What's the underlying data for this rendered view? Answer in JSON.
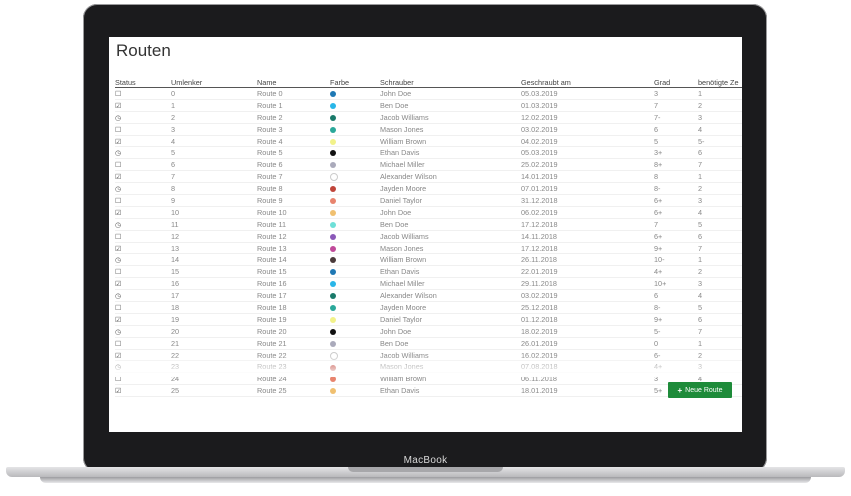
{
  "device": {
    "brand": "MacBook"
  },
  "page": {
    "title": "Routen"
  },
  "table": {
    "headers": [
      "Status",
      "Umlenker",
      "Name",
      "Farbe",
      "Schrauber",
      "Geschraubt am",
      "Grad",
      "benötigte Ze"
    ],
    "rows": [
      {
        "status": "empty",
        "umlenker": "0",
        "name": "Route 0",
        "color": "#1f78b4",
        "schrauber": "John Doe",
        "date": "05.03.2019",
        "grad": "3",
        "zeit": "1"
      },
      {
        "status": "checked",
        "umlenker": "1",
        "name": "Route 1",
        "color": "#29b6e8",
        "schrauber": "Ben Doe",
        "date": "01.03.2019",
        "grad": "7",
        "zeit": "2"
      },
      {
        "status": "clock",
        "umlenker": "2",
        "name": "Route 2",
        "color": "#1a7a6a",
        "schrauber": "Jacob Williams",
        "date": "12.02.2019",
        "grad": "7-",
        "zeit": "3"
      },
      {
        "status": "empty",
        "umlenker": "3",
        "name": "Route 3",
        "color": "#2aa89a",
        "schrauber": "Mason Jones",
        "date": "03.02.2019",
        "grad": "6",
        "zeit": "4"
      },
      {
        "status": "checked",
        "umlenker": "4",
        "name": "Route 4",
        "color": "#f2f28a",
        "schrauber": "William Brown",
        "date": "04.02.2019",
        "grad": "5",
        "zeit": "5-"
      },
      {
        "status": "clock",
        "umlenker": "5",
        "name": "Route 5",
        "color": "#111111",
        "schrauber": "Ethan Davis",
        "date": "05.03.2019",
        "grad": "3+",
        "zeit": "6"
      },
      {
        "status": "empty",
        "umlenker": "6",
        "name": "Route 6",
        "color": "#aaaabb",
        "schrauber": "Michael Miller",
        "date": "25.02.2019",
        "grad": "8+",
        "zeit": "7"
      },
      {
        "status": "checked",
        "umlenker": "7",
        "name": "Route 7",
        "color": "#ffffff",
        "schrauber": "Alexander Wilson",
        "date": "14.01.2019",
        "grad": "8",
        "zeit": "1"
      },
      {
        "status": "clock",
        "umlenker": "8",
        "name": "Route 8",
        "color": "#c0453a",
        "schrauber": "Jayden Moore",
        "date": "07.01.2019",
        "grad": "8-",
        "zeit": "2"
      },
      {
        "status": "empty",
        "umlenker": "9",
        "name": "Route 9",
        "color": "#e8846e",
        "schrauber": "Daniel Taylor",
        "date": "31.12.2018",
        "grad": "6+",
        "zeit": "3"
      },
      {
        "status": "checked",
        "umlenker": "10",
        "name": "Route 10",
        "color": "#f0c070",
        "schrauber": "John Doe",
        "date": "06.02.2019",
        "grad": "6+",
        "zeit": "4"
      },
      {
        "status": "clock",
        "umlenker": "11",
        "name": "Route 11",
        "color": "#6ee0d8",
        "schrauber": "Ben Doe",
        "date": "17.12.2018",
        "grad": "7",
        "zeit": "5"
      },
      {
        "status": "empty",
        "umlenker": "12",
        "name": "Route 12",
        "color": "#8a58b8",
        "schrauber": "Jacob Williams",
        "date": "14.11.2018",
        "grad": "6+",
        "zeit": "6"
      },
      {
        "status": "checked",
        "umlenker": "13",
        "name": "Route 13",
        "color": "#c04a9a",
        "schrauber": "Mason Jones",
        "date": "17.12.2018",
        "grad": "9+",
        "zeit": "7"
      },
      {
        "status": "clock",
        "umlenker": "14",
        "name": "Route 14",
        "color": "#4a3a3a",
        "schrauber": "William Brown",
        "date": "26.11.2018",
        "grad": "10-",
        "zeit": "1"
      },
      {
        "status": "empty",
        "umlenker": "15",
        "name": "Route 15",
        "color": "#1f78b4",
        "schrauber": "Ethan Davis",
        "date": "22.01.2019",
        "grad": "4+",
        "zeit": "2"
      },
      {
        "status": "checked",
        "umlenker": "16",
        "name": "Route 16",
        "color": "#29b6e8",
        "schrauber": "Michael Miller",
        "date": "29.11.2018",
        "grad": "10+",
        "zeit": "3"
      },
      {
        "status": "clock",
        "umlenker": "17",
        "name": "Route 17",
        "color": "#1a7a6a",
        "schrauber": "Alexander Wilson",
        "date": "03.02.2019",
        "grad": "6",
        "zeit": "4"
      },
      {
        "status": "empty",
        "umlenker": "18",
        "name": "Route 18",
        "color": "#2aa89a",
        "schrauber": "Jayden Moore",
        "date": "25.12.2018",
        "grad": "8-",
        "zeit": "5"
      },
      {
        "status": "checked",
        "umlenker": "19",
        "name": "Route 19",
        "color": "#f2f28a",
        "schrauber": "Daniel Taylor",
        "date": "01.12.2018",
        "grad": "9+",
        "zeit": "6"
      },
      {
        "status": "clock",
        "umlenker": "20",
        "name": "Route 20",
        "color": "#111111",
        "schrauber": "John Doe",
        "date": "18.02.2019",
        "grad": "5-",
        "zeit": "7"
      },
      {
        "status": "empty",
        "umlenker": "21",
        "name": "Route 21",
        "color": "#aaaabb",
        "schrauber": "Ben Doe",
        "date": "26.01.2019",
        "grad": "0",
        "zeit": "1"
      },
      {
        "status": "checked",
        "umlenker": "22",
        "name": "Route 22",
        "color": "#ffffff",
        "schrauber": "Jacob Williams",
        "date": "16.02.2019",
        "grad": "6-",
        "zeit": "2"
      },
      {
        "status": "clock",
        "umlenker": "23",
        "name": "Route 23",
        "color": "#c0453a",
        "schrauber": "Mason Jones",
        "date": "07.08.2018",
        "grad": "4+",
        "zeit": "3"
      },
      {
        "status": "empty",
        "umlenker": "24",
        "name": "Route 24",
        "color": "#e8846e",
        "schrauber": "William Brown",
        "date": "06.11.2018",
        "grad": "3",
        "zeit": "4"
      },
      {
        "status": "checked",
        "umlenker": "25",
        "name": "Route 25",
        "color": "#f0c070",
        "schrauber": "Ethan Davis",
        "date": "18.01.2019",
        "grad": "5+",
        "zeit": "5"
      }
    ]
  },
  "actions": {
    "new_route_label": "Neue Route"
  },
  "icons": {
    "empty": "☐",
    "checked": "☑",
    "clock": "◷",
    "plus": "+"
  }
}
